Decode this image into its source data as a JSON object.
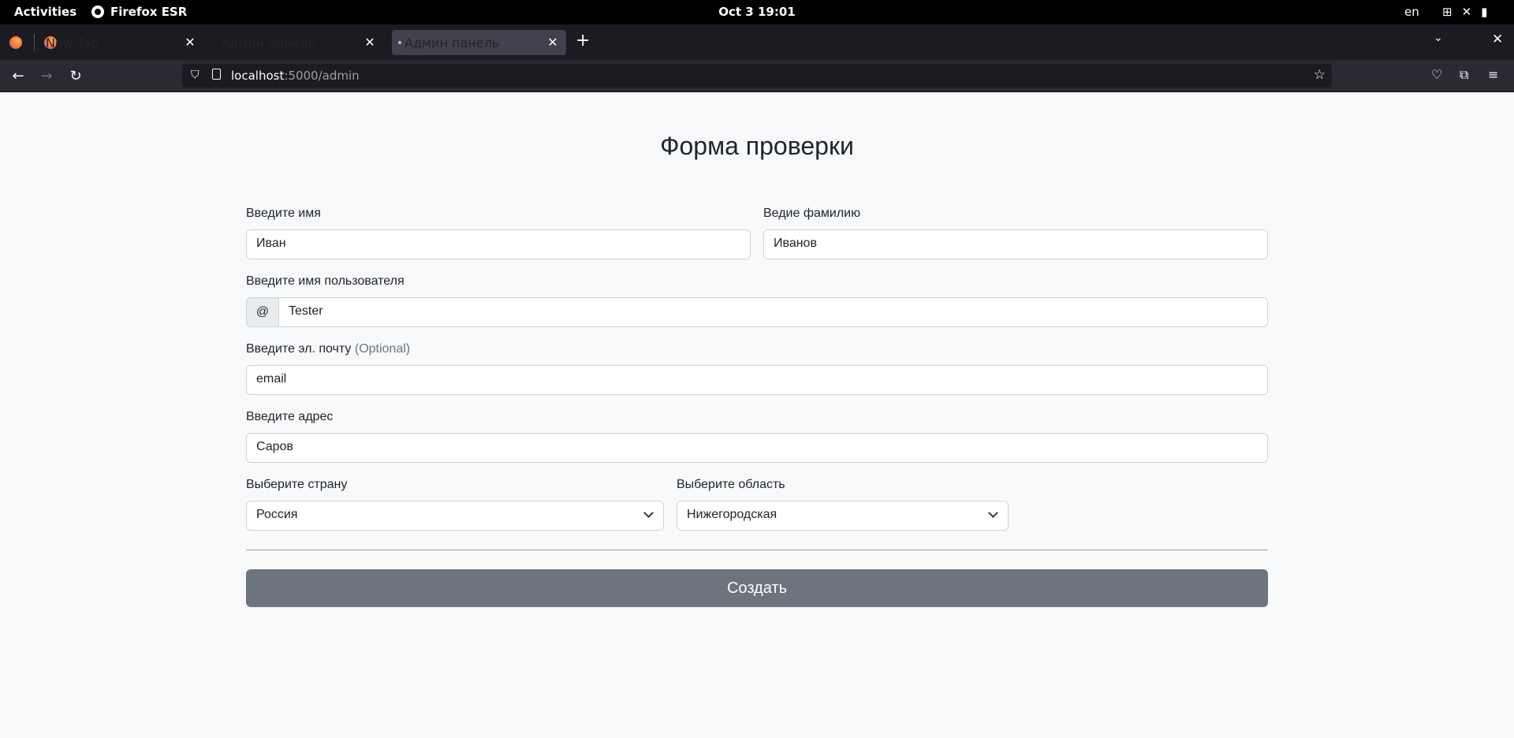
{
  "system": {
    "activities": "Activities",
    "app_name": "Firefox ESR",
    "clock": "Oct 3  19:01",
    "lang": "en"
  },
  "browser": {
    "tabs": [
      {
        "label": "New Tab"
      },
      {
        "label": "Админ панель"
      },
      {
        "label": "Админ панель"
      }
    ],
    "url_host": "localhost",
    "url_path": ":5000/admin"
  },
  "form": {
    "title": "Форма проверки",
    "first_name_label": "Введите имя",
    "first_name_value": "Иван",
    "last_name_label": "Ведие фамилию",
    "last_name_value": "Иванов",
    "username_label": "Введите имя пользователя",
    "username_prefix": "@",
    "username_value": "Tester",
    "email_label": "Введите эл. почту",
    "email_optional": "(Optional)",
    "email_value": "email",
    "address_label": "Введите адрес",
    "address_value": "Саров",
    "country_label": "Выберите страну",
    "country_value": "Россия",
    "region_label": "Выберите область",
    "region_value": "Нижегородская",
    "submit_label": "Создать"
  }
}
